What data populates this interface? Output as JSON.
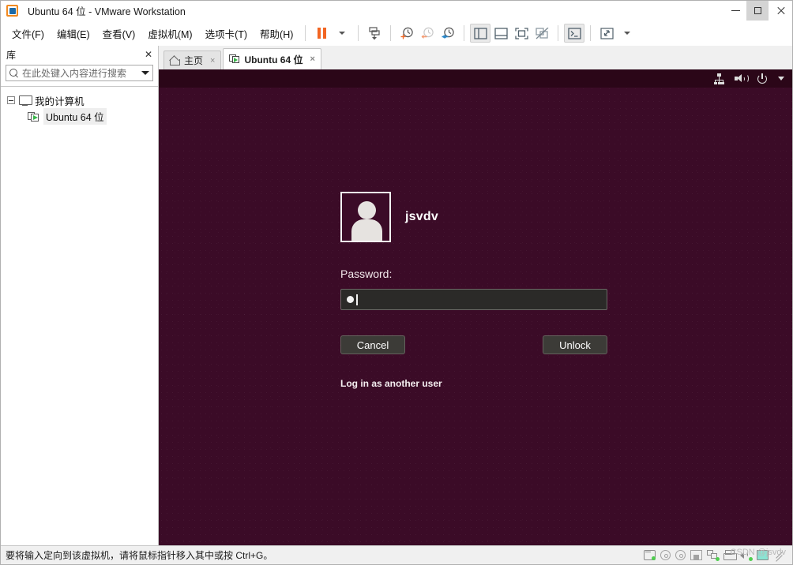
{
  "window": {
    "title": "Ubuntu 64 位 - VMware Workstation",
    "logo_icon": "vmware-logo-icon",
    "controls": {
      "minimize": "minimize-icon",
      "maximize": "maximize-icon",
      "close": "close-icon"
    }
  },
  "menubar": {
    "items": [
      {
        "label": "文件(F)"
      },
      {
        "label": "编辑(E)"
      },
      {
        "label": "查看(V)"
      },
      {
        "label": "虚拟机(M)"
      },
      {
        "label": "选项卡(T)"
      },
      {
        "label": "帮助(H)"
      }
    ]
  },
  "toolbar": {
    "buttons": [
      {
        "name": "suspend-button",
        "icon": "pause-icon"
      },
      {
        "name": "power-dropdown",
        "icon": "chevron-down-icon"
      },
      {
        "name": "snapshot-button",
        "icon": "snapshot-icon"
      },
      {
        "name": "take-snapshot-button",
        "icon": "clock-plus-icon"
      },
      {
        "name": "revert-snapshot-button",
        "icon": "clock-back-icon"
      },
      {
        "name": "snapshot-manager-button",
        "icon": "clock-settings-icon"
      },
      {
        "name": "show-library-button",
        "icon": "library-panel-icon"
      },
      {
        "name": "show-console-button",
        "icon": "console-view-icon"
      },
      {
        "name": "fullscreen-button",
        "icon": "fullscreen-icon"
      },
      {
        "name": "unity-mode-button",
        "icon": "unity-mode-disabled-icon"
      },
      {
        "name": "send-ctrl-alt-del-button",
        "icon": "terminal-icon"
      },
      {
        "name": "stretch-guest-button",
        "icon": "resize-arrows-icon"
      },
      {
        "name": "stretch-dropdown",
        "icon": "chevron-down-icon"
      }
    ]
  },
  "sidebar": {
    "title": "库",
    "close_icon": "close-icon",
    "search": {
      "placeholder": "在此处键入内容进行搜索",
      "value": "",
      "icon": "search-icon",
      "dropdown_icon": "chevron-down-icon"
    },
    "tree": [
      {
        "label": "我的计算机",
        "icon": "monitor-icon",
        "expanded": true
      },
      {
        "label": "Ubuntu 64 位",
        "icon": "virtual-machine-running-icon",
        "selected": true
      }
    ]
  },
  "tabs": [
    {
      "label": "主页",
      "icon": "home-icon",
      "active": false,
      "close_icon": "×"
    },
    {
      "label": "Ubuntu 64 位",
      "icon": "virtual-machine-running-icon",
      "active": true,
      "close_icon": "×"
    }
  ],
  "guest": {
    "panel": {
      "icons": [
        {
          "name": "network-icon"
        },
        {
          "name": "volume-icon"
        },
        {
          "name": "power-icon"
        },
        {
          "name": "chevron-down-icon"
        }
      ]
    },
    "lock_screen": {
      "avatar_icon": "user-avatar-icon",
      "username": "jsvdv",
      "password_label": "Password:",
      "password_value": "•",
      "cancel_label": "Cancel",
      "unlock_label": "Unlock",
      "other_user_label": "Log in as another user"
    }
  },
  "statusbar": {
    "message": "要将输入定向到该虚拟机，请将鼠标指针移入其中或按 Ctrl+G。",
    "devices": [
      {
        "name": "hard-disk-icon",
        "connected": true
      },
      {
        "name": "cd-dvd-icon",
        "connected": false
      },
      {
        "name": "cd-dvd-2-icon",
        "connected": false
      },
      {
        "name": "floppy-icon",
        "connected": false
      },
      {
        "name": "network-adapter-icon",
        "connected": true
      },
      {
        "name": "printer-icon",
        "connected": false
      },
      {
        "name": "sound-card-icon",
        "connected": true
      },
      {
        "name": "usb-device-icon",
        "connected": false
      }
    ],
    "watermark": "CSDN @jsvdv"
  },
  "colors": {
    "ubuntu_background": "#3b0b27",
    "ubuntu_panel": "#2b0618",
    "accent_orange": "#f26522",
    "green_indicator": "#3ecb3e"
  }
}
